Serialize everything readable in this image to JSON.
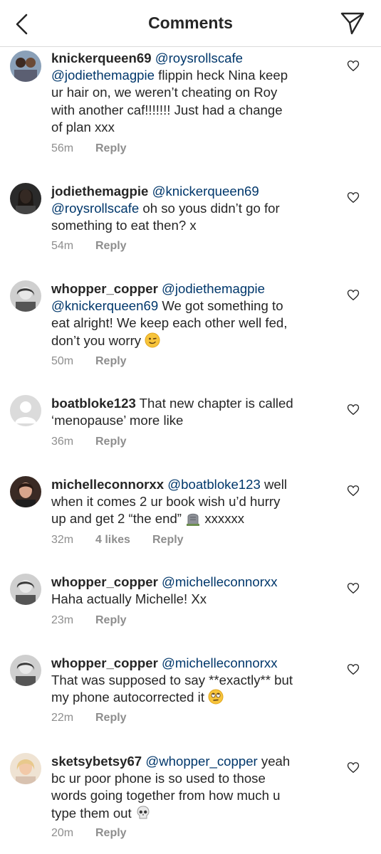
{
  "header": {
    "title": "Comments",
    "back_icon": "chevron-left-icon",
    "send_icon": "paper-plane-icon"
  },
  "comments": [
    {
      "username": "knickerqueen69",
      "lines": [
        {
          "mention": "@roysrollscafe",
          "text": ""
        },
        {
          "mention": "@jodiethemagpie",
          "text": " flippin heck Nina keep"
        },
        {
          "mention": "",
          "text": "ur hair on, we weren’t cheating on Roy"
        },
        {
          "mention": "",
          "text": "with another caf!!!!!!! Just had a change"
        },
        {
          "mention": "",
          "text": "of plan xxx"
        }
      ],
      "time": "56m",
      "likes": "",
      "reply": "Reply"
    },
    {
      "username": "jodiethemagpie",
      "lines": [
        {
          "mention": "@knickerqueen69",
          "text": ""
        },
        {
          "mention": "@roysrollscafe",
          "text": " oh so yous didn’t go for"
        },
        {
          "mention": "",
          "text": "something to eat then? x"
        }
      ],
      "time": "54m",
      "likes": "",
      "reply": "Reply"
    },
    {
      "username": "whopper_copper",
      "lines": [
        {
          "mention": "@jodiethemagpie",
          "text": ""
        },
        {
          "mention": "@knickerqueen69",
          "text": " We got something to"
        },
        {
          "mention": "",
          "text": "eat alright! We keep each other well fed,"
        },
        {
          "mention": "",
          "text": "don’t you worry"
        }
      ],
      "time": "50m",
      "likes": "",
      "reply": "Reply",
      "emoji": "winking-face-emoji"
    },
    {
      "username": "boatbloke123",
      "lines": [
        {
          "mention": "",
          "text": " That new chapter is called"
        },
        {
          "mention": "",
          "text": "‘menopause’ more like"
        }
      ],
      "time": "36m",
      "likes": "",
      "reply": "Reply"
    },
    {
      "username": "michelleconnorxx",
      "lines": [
        {
          "mention": "@boatbloke123",
          "text": " well"
        },
        {
          "mention": "",
          "text": "when it comes 2 ur book wish u’d hurry"
        },
        {
          "mention": "",
          "text": "up and get 2 “the end”"
        },
        {
          "mention": "",
          "text": " xxxxxx"
        }
      ],
      "time": "32m",
      "likes": "4 likes",
      "reply": "Reply",
      "emoji": "headstone-emoji"
    },
    {
      "username": "whopper_copper",
      "lines": [
        {
          "mention": "@michelleconnorxx",
          "text": ""
        },
        {
          "mention": "",
          "text": "Haha actually Michelle! Xx"
        }
      ],
      "time": "23m",
      "likes": "",
      "reply": "Reply"
    },
    {
      "username": "whopper_copper",
      "lines": [
        {
          "mention": "@michelleconnorxx",
          "text": ""
        },
        {
          "mention": "",
          "text": "That was supposed to say **exactly** but"
        },
        {
          "mention": "",
          "text": "my phone autocorrected it"
        }
      ],
      "time": "22m",
      "likes": "",
      "reply": "Reply",
      "emoji": "eye-roll-emoji"
    },
    {
      "username": "sketsybetsy67",
      "lines": [
        {
          "mention": "@whopper_copper",
          "text": " yeah"
        },
        {
          "mention": "",
          "text": "bc ur poor phone is so used to those"
        },
        {
          "mention": "",
          "text": "words going together from how much u"
        },
        {
          "mention": "",
          "text": "type them out"
        }
      ],
      "time": "20m",
      "likes": "",
      "reply": "Reply",
      "emoji": "skull-emoji"
    }
  ],
  "colors": {
    "text": "#262626",
    "mention": "#00376b",
    "meta": "#8e8e8e",
    "divider": "#dbdbdb"
  }
}
